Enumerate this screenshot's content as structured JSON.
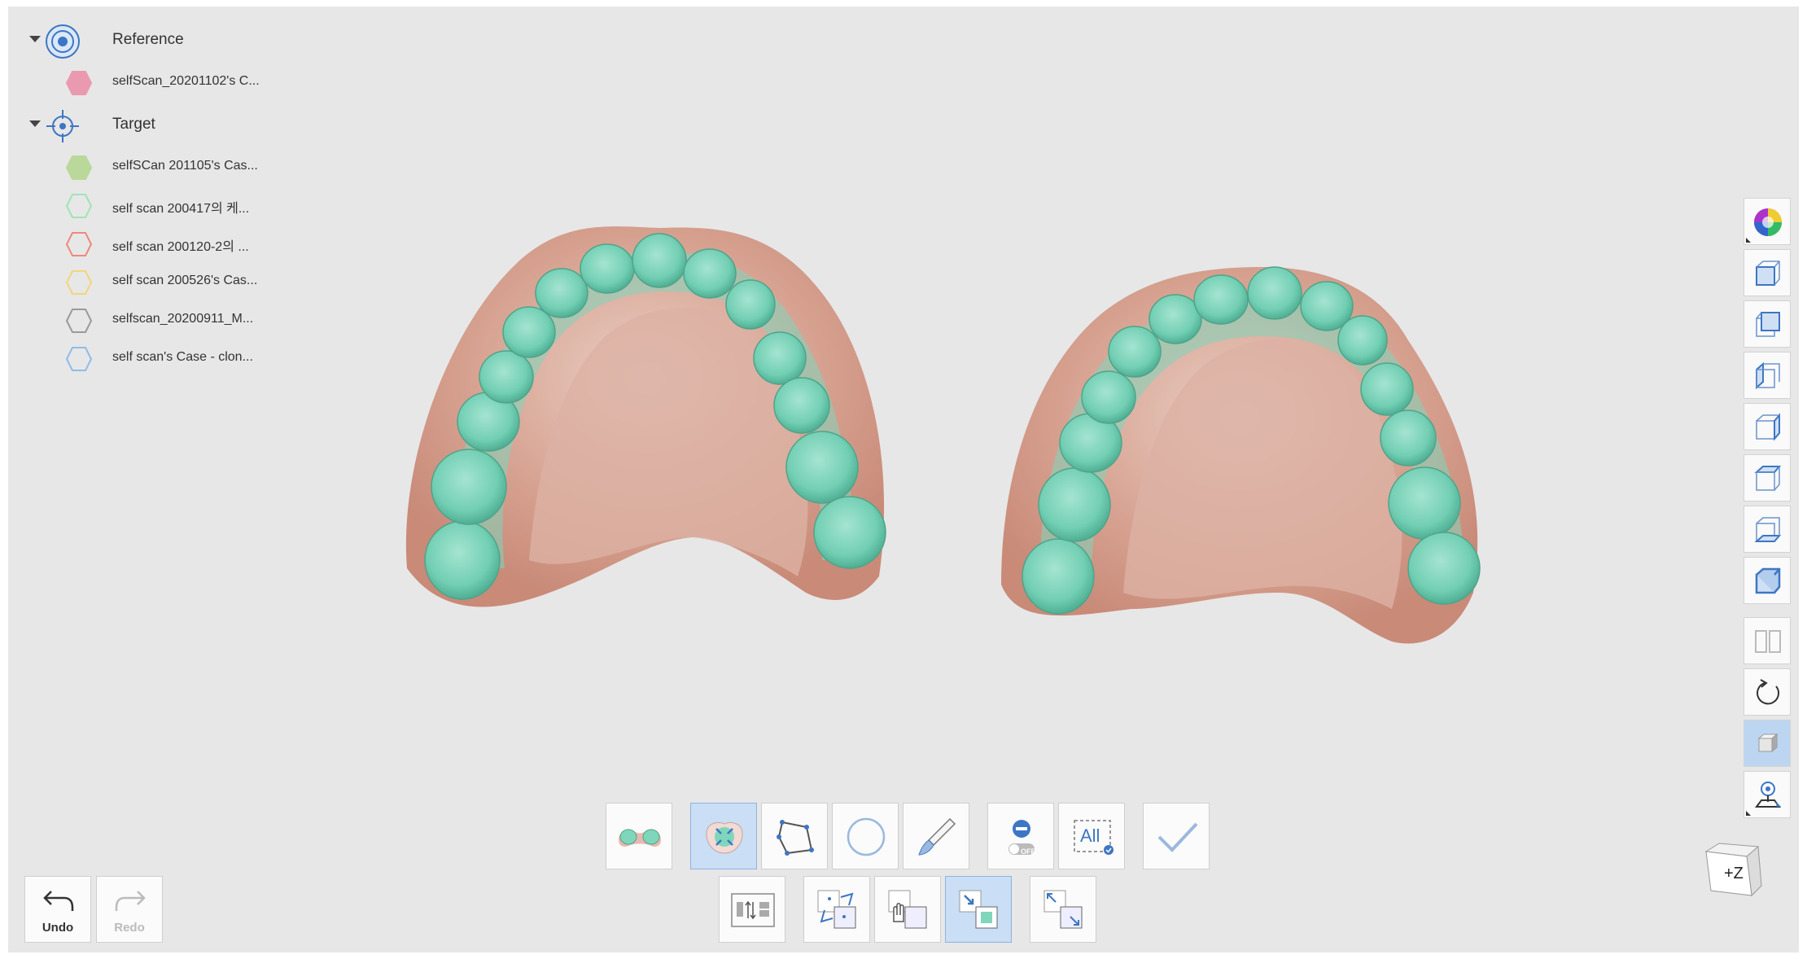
{
  "tree": {
    "reference": {
      "label": "Reference",
      "items": [
        {
          "label": "selfScan_20201102's C...",
          "color": "#ea9ab0",
          "filled": true
        }
      ]
    },
    "target": {
      "label": "Target",
      "items": [
        {
          "label": "selfSCan 201105's Cas...",
          "color": "#b9d89a",
          "filled": true
        },
        {
          "label": "self scan 200417의 케...",
          "color": "#9fe3b6",
          "filled": false
        },
        {
          "label": "self scan 200120-2의 ...",
          "color": "#ec8a7a",
          "filled": false
        },
        {
          "label": "self scan 200526's Cas...",
          "color": "#f2d67a",
          "filled": false
        },
        {
          "label": "selfscan_20200911_M...",
          "color": "#9a9a9a",
          "filled": false
        },
        {
          "label": "self scan's Case - clon...",
          "color": "#8ebde8",
          "filled": false
        }
      ]
    }
  },
  "right_toolbar": [
    {
      "icon": "color-wheel-icon"
    },
    {
      "icon": "view-front-cube-icon"
    },
    {
      "icon": "view-back-cube-icon"
    },
    {
      "icon": "view-left-cube-icon"
    },
    {
      "icon": "view-right-cube-icon"
    },
    {
      "icon": "view-top-cube-icon"
    },
    {
      "icon": "view-bottom-cube-icon"
    },
    {
      "icon": "view-iso-cube-icon"
    },
    {
      "icon": "split-view-icon"
    },
    {
      "icon": "rotate-icon"
    },
    {
      "icon": "solid-cube-icon"
    },
    {
      "icon": "eye-locate-icon"
    }
  ],
  "toolbar_top": [
    {
      "icon": "teeth-select-icon",
      "active": false
    },
    {
      "icon": "smart-select-icon",
      "active": true
    },
    {
      "icon": "polygon-select-icon",
      "active": false
    },
    {
      "icon": "circle-select-icon",
      "active": false
    },
    {
      "icon": "brush-select-icon",
      "active": false
    },
    {
      "icon": "deselect-toggle-icon",
      "active": false,
      "toggle_text": "OFF"
    },
    {
      "icon": "select-all-icon",
      "active": false,
      "text": "All"
    },
    {
      "icon": "apply-check-icon",
      "active": false
    }
  ],
  "toolbar_bottom": [
    {
      "icon": "align-settings-icon",
      "active": false
    },
    {
      "icon": "align-point-icon",
      "active": false
    },
    {
      "icon": "align-hand-icon",
      "active": false
    },
    {
      "icon": "align-best-fit-icon",
      "active": true
    },
    {
      "icon": "align-expand-icon",
      "active": false
    }
  ],
  "undo": {
    "label": "Undo"
  },
  "redo": {
    "label": "Redo"
  },
  "orientation_cube": {
    "label": "+Z"
  }
}
